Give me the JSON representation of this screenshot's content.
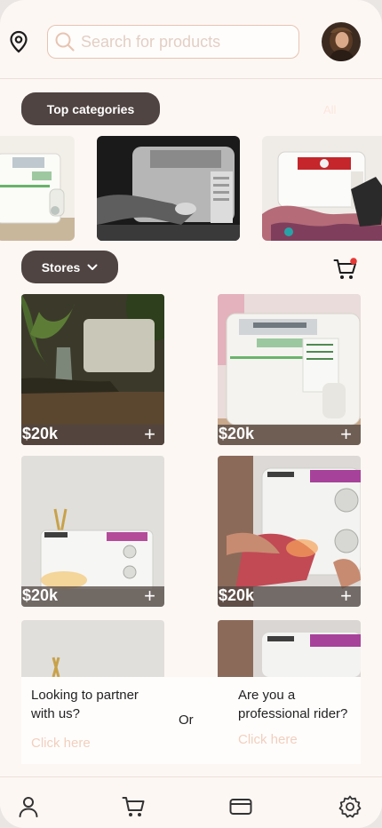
{
  "header": {
    "location_icon": "map-pin-icon",
    "search": {
      "placeholder": "Search for products",
      "value": ""
    },
    "avatar_icon": "user-avatar"
  },
  "categories": {
    "label": "Top categories",
    "all_link": "All",
    "images": [
      "sewing-machine-white",
      "sewing-machine-bw-hands",
      "sewing-machine-red-fabric"
    ]
  },
  "stores": {
    "label": "Stores",
    "dropdown_icon": "chevron-down-icon",
    "cart_badge_color": "#e53935"
  },
  "products": [
    {
      "price": "$20k",
      "action": "+"
    },
    {
      "price": "$20k",
      "action": "+"
    },
    {
      "price": "$20k",
      "action": "+"
    },
    {
      "price": "$20k",
      "action": "+"
    }
  ],
  "partner_banner": {
    "left_question": "Looking to partner with us?",
    "left_link": "Click here",
    "or_text": "Or",
    "right_question": "Are you a professional rider?",
    "right_link": "Click here"
  },
  "bottom_nav": [
    "profile-icon",
    "cart-icon",
    "card-icon",
    "settings-icon"
  ],
  "colors": {
    "pill_bg": "#4f4441",
    "accent_peach": "#e7c4b1",
    "link": "#f1cfbd",
    "page_bg": "#fdf7f4"
  }
}
